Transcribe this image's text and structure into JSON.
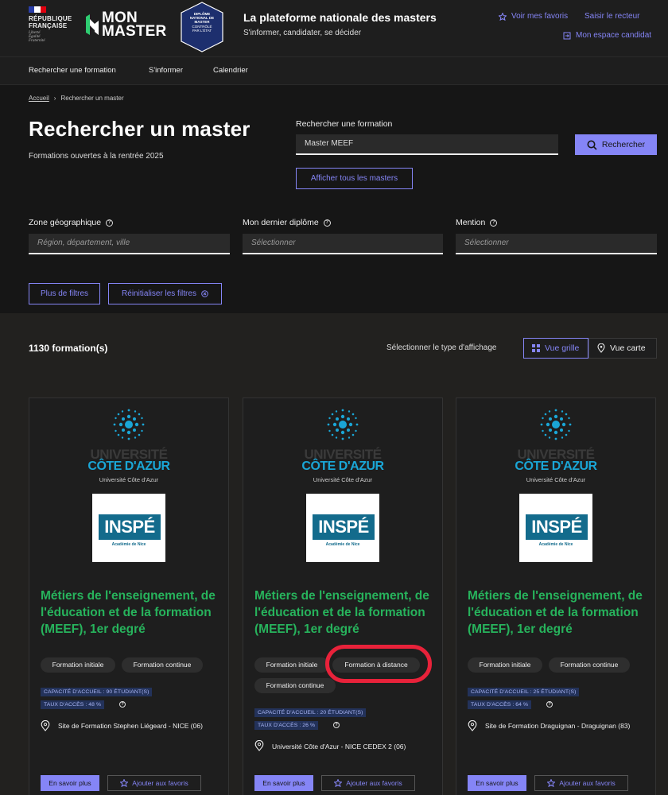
{
  "header": {
    "rf_line1": "RÉPUBLIQUE",
    "rf_line2": "FRANÇAISE",
    "rf_motto1": "Liberté",
    "rf_motto2": "Égalité",
    "rf_motto3": "Fraternité",
    "brand_line1": "MON",
    "brand_line2": "MASTER",
    "badge_line1": "DIPLÔME",
    "badge_line2": "NATIONAL DE",
    "badge_line3": "MASTER",
    "badge_line4": "CONTRÔLÉ",
    "badge_line5": "PAR L'ÉTAT",
    "title": "La plateforme nationale des masters",
    "subtitle": "S'informer, candidater, se décider",
    "link_favoris": "Voir mes favoris",
    "link_recteur": "Saisir le recteur",
    "link_espace": "Mon espace candidat"
  },
  "nav": {
    "items": [
      "Rechercher une formation",
      "S'informer",
      "Calendrier"
    ]
  },
  "breadcrumb": {
    "home": "Accueil",
    "current": "Rechercher un master"
  },
  "search": {
    "title": "Rechercher un master",
    "subtitle": "Formations ouvertes à la rentrée 2025",
    "formation_label": "Rechercher une formation",
    "formation_value": "Master MEEF",
    "submit_label": "Rechercher",
    "show_all_label": "Afficher tous les masters",
    "filters": [
      {
        "label": "Zone géographique",
        "placeholder": "Région, département, ville"
      },
      {
        "label": "Mon dernier diplôme",
        "placeholder": "Sélectionner"
      },
      {
        "label": "Mention",
        "placeholder": "Sélectionner"
      }
    ],
    "more_filters": "Plus de filtres",
    "reset_filters": "Réinitialiser les filtres"
  },
  "results": {
    "count": "1130 formation(s)",
    "display_label": "Sélectionner le type d'affichage",
    "view_grid": "Vue grille",
    "view_map": "Vue carte"
  },
  "colors": {
    "accent": "#8585f6",
    "title_green": "#27b35c",
    "annotation": "#e8223a"
  },
  "cards": [
    {
      "uni_ghost": "UNIVERSITÉ",
      "uni_name": "CÔTE D'AZUR",
      "uni_caption": "Université Côte d'Azur",
      "inspe": "INSPÉ",
      "inspe_sub": "Académie de Nice",
      "title": "Métiers de l'enseignement, de l'éducation et de la formation (MEEF), 1er degré",
      "tags": [
        "Formation initiale",
        "Formation continue"
      ],
      "capacity": "CAPACITÉ D'ACCUEIL : 90 ÉTUDIANT(S)",
      "access": "TAUX D'ACCÈS : 48 %",
      "location": "Site de Formation Stephen Liégeard - NICE (06)",
      "more": "En savoir plus",
      "fav": "Ajouter aux favoris"
    },
    {
      "uni_ghost": "UNIVERSITÉ",
      "uni_name": "CÔTE D'AZUR",
      "uni_caption": "Université Côte d'Azur",
      "inspe": "INSPÉ",
      "inspe_sub": "Académie de Nice",
      "title": "Métiers de l'enseignement, de l'éducation et de la formation (MEEF), 1er degré",
      "tags": [
        "Formation initiale",
        "Formation à distance",
        "Formation continue"
      ],
      "capacity": "CAPACITÉ D'ACCUEIL : 20 ÉTUDIANT(S)",
      "access": "TAUX D'ACCÈS : 26 %",
      "location": "Université Côte d'Azur - NICE CEDEX 2 (06)",
      "more": "En savoir plus",
      "fav": "Ajouter aux favoris"
    },
    {
      "uni_ghost": "UNIVERSITÉ",
      "uni_name": "CÔTE D'AZUR",
      "uni_caption": "Université Côte d'Azur",
      "inspe": "INSPÉ",
      "inspe_sub": "Académie de Nice",
      "title": "Métiers de l'enseignement, de l'éducation et de la formation (MEEF), 1er degré",
      "tags": [
        "Formation initiale",
        "Formation continue"
      ],
      "capacity": "CAPACITÉ D'ACCUEIL : 25 ÉTUDIANT(S)",
      "access": "TAUX D'ACCÈS : 64 %",
      "location": "Site de Formation Draguignan - Draguignan (83)",
      "more": "En savoir plus",
      "fav": "Ajouter aux favoris"
    }
  ]
}
